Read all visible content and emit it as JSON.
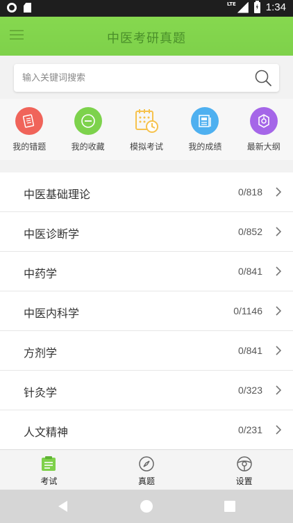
{
  "status_bar": {
    "time": "1:34",
    "network": "LTE"
  },
  "app_bar": {
    "title": "中医考研真题"
  },
  "search": {
    "placeholder": "输入关键词搜索"
  },
  "shortcuts": [
    {
      "label": "我的错题",
      "icon": "wrong-questions-icon",
      "color": "#f0645a"
    },
    {
      "label": "我的收藏",
      "icon": "favorites-icon",
      "color": "#7dd24c"
    },
    {
      "label": "模拟考试",
      "icon": "mock-exam-icon",
      "color": "#f6c24d"
    },
    {
      "label": "我的成绩",
      "icon": "scores-icon",
      "color": "#4eb0f0"
    },
    {
      "label": "最新大纲",
      "icon": "syllabus-icon",
      "color": "#a566e8"
    }
  ],
  "subjects": [
    {
      "name": "中医基础理论",
      "count": "0/818"
    },
    {
      "name": "中医诊断学",
      "count": "0/852"
    },
    {
      "name": "中药学",
      "count": "0/841"
    },
    {
      "name": "中医内科学",
      "count": "0/1146"
    },
    {
      "name": "方剂学",
      "count": "0/841"
    },
    {
      "name": "针灸学",
      "count": "0/323"
    },
    {
      "name": "人文精神",
      "count": "0/231"
    }
  ],
  "bottom_nav": [
    {
      "label": "考试",
      "icon": "exam-icon",
      "active": true
    },
    {
      "label": "真题",
      "icon": "compass-icon",
      "active": false
    },
    {
      "label": "设置",
      "icon": "steering-wheel-icon",
      "active": false
    }
  ],
  "colors": {
    "primary": "#7ed14a",
    "status_bar": "#1e1e1e"
  }
}
